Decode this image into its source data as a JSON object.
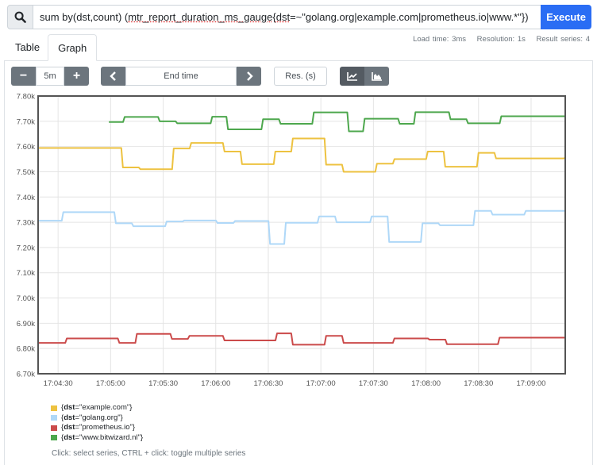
{
  "query": {
    "icon": "search-icon",
    "value": "sum by(dst,count) (mtr_report_duration_ms_gauge{dst=~\"golang.org|example.com|prometheus.io|www.*\"})",
    "value_plain_prefix": "sum by(dst,count) (",
    "value_underlined": "mtr_report_duration_ms_gauge",
    "value_suffix_a": "{",
    "value_underlined_b": "dst",
    "value_suffix_b": "=~\"golang.org|example.com|prometheus.io|www.*\"})",
    "execute_label": "Execute"
  },
  "stats": {
    "load_time": "Load time: 3ms",
    "resolution": "Resolution: 1s",
    "result_series": "Result series: 4"
  },
  "tabs": [
    {
      "label": "Table",
      "active": false
    },
    {
      "label": "Graph",
      "active": true
    }
  ],
  "controls": {
    "range_minus": "−",
    "range_value": "5m",
    "range_plus": "+",
    "prev": "‹",
    "end_time_placeholder": "End time",
    "next": "›",
    "resolution_placeholder": "Res. (s)",
    "graph_types": [
      {
        "icon": "line-chart-icon",
        "active": true
      },
      {
        "icon": "area-chart-icon",
        "active": false
      }
    ]
  },
  "chart_data": {
    "type": "line",
    "title": "",
    "xlabel": "",
    "ylabel": "",
    "x_unit": "seconds after 17:04:00",
    "xlim": [
      18.6,
      319.5
    ],
    "ylim": [
      6700,
      7800
    ],
    "yticks": [
      6700,
      6800,
      6900,
      7000,
      7100,
      7200,
      7300,
      7400,
      7500,
      7600,
      7700,
      7800
    ],
    "ytick_labels": [
      "6.70k",
      "6.80k",
      "6.90k",
      "7.00k",
      "7.10k",
      "7.20k",
      "7.30k",
      "7.40k",
      "7.50k",
      "7.60k",
      "7.70k",
      "7.80k"
    ],
    "xticks": [
      30,
      60,
      90,
      120,
      150,
      180,
      210,
      240,
      270,
      300
    ],
    "xtick_labels": [
      "17:04:30",
      "17:05:00",
      "17:05:30",
      "17:06:00",
      "17:06:30",
      "17:07:00",
      "17:07:30",
      "17:08:00",
      "17:08:30",
      "17:09:00"
    ],
    "grid": true,
    "legend_position": "bottom-left",
    "series": [
      {
        "name": "{dst=\"example.com\"}",
        "label_key": "dst",
        "label_value": "example.com",
        "color": "#edc240",
        "steps": [
          [
            18.6,
            7594
          ],
          [
            67,
            7517
          ],
          [
            77,
            7510
          ],
          [
            96,
            7592
          ],
          [
            106,
            7614
          ],
          [
            125,
            7580
          ],
          [
            135,
            7530
          ],
          [
            154,
            7580
          ],
          [
            164,
            7632
          ],
          [
            183,
            7528
          ],
          [
            193,
            7500
          ],
          [
            212,
            7532
          ],
          [
            222,
            7550
          ],
          [
            241,
            7580
          ],
          [
            251,
            7520
          ],
          [
            270,
            7575
          ],
          [
            280,
            7553
          ],
          [
            319.5,
            7555
          ]
        ]
      },
      {
        "name": "{dst=\"golang.org\"}",
        "label_key": "dst",
        "label_value": "golang.org",
        "color": "#afd8f8",
        "steps": [
          [
            18.6,
            7306
          ],
          [
            33,
            7340
          ],
          [
            63,
            7296
          ],
          [
            73,
            7284
          ],
          [
            92,
            7303
          ],
          [
            102,
            7307
          ],
          [
            121,
            7297
          ],
          [
            131,
            7305
          ],
          [
            151,
            7214
          ],
          [
            160,
            7298
          ],
          [
            179,
            7323
          ],
          [
            189,
            7300
          ],
          [
            209,
            7323
          ],
          [
            219,
            7222
          ],
          [
            238,
            7296
          ],
          [
            248,
            7288
          ],
          [
            268,
            7345
          ],
          [
            278,
            7330
          ],
          [
            297,
            7345
          ],
          [
            319.5,
            7345
          ]
        ]
      },
      {
        "name": "{dst=\"prometheus.io\"}",
        "label_key": "dst",
        "label_value": "prometheus.io",
        "color": "#cb4b4b",
        "steps": [
          [
            18.6,
            6822
          ],
          [
            35,
            6840
          ],
          [
            65,
            6822
          ],
          [
            75,
            6858
          ],
          [
            95,
            6838
          ],
          [
            105,
            6850
          ],
          [
            125,
            6832
          ],
          [
            155,
            6860
          ],
          [
            164,
            6815
          ],
          [
            183,
            6850
          ],
          [
            193,
            6822
          ],
          [
            222,
            6840
          ],
          [
            242,
            6835
          ],
          [
            252,
            6817
          ],
          [
            282,
            6843
          ],
          [
            319.5,
            6843
          ]
        ]
      },
      {
        "name": "{dst=\"www.bitwizard.nl\"}",
        "label_key": "dst",
        "label_value": "www.bitwizard.nl",
        "color": "#4da74d",
        "steps": [
          [
            59,
            7697
          ],
          [
            68,
            7717
          ],
          [
            88,
            7700
          ],
          [
            98,
            7692
          ],
          [
            118,
            7718
          ],
          [
            127,
            7668
          ],
          [
            147,
            7708
          ],
          [
            157,
            7690
          ],
          [
            176,
            7735
          ],
          [
            196,
            7660
          ],
          [
            205,
            7710
          ],
          [
            225,
            7690
          ],
          [
            234,
            7736
          ],
          [
            254,
            7708
          ],
          [
            264,
            7692
          ],
          [
            283,
            7720
          ],
          [
            319.5,
            7720
          ]
        ]
      }
    ]
  },
  "legend": {
    "items": [
      {
        "key": "dst",
        "value": "\"example.com\"",
        "color": "#edc240"
      },
      {
        "key": "dst",
        "value": "\"golang.org\"",
        "color": "#afd8f8"
      },
      {
        "key": "dst",
        "value": "\"prometheus.io\"",
        "color": "#cb4b4b"
      },
      {
        "key": "dst",
        "value": "\"www.bitwizard.nl\"",
        "color": "#4da74d"
      }
    ],
    "hint": "Click: select series, CTRL + click: toggle multiple series"
  }
}
